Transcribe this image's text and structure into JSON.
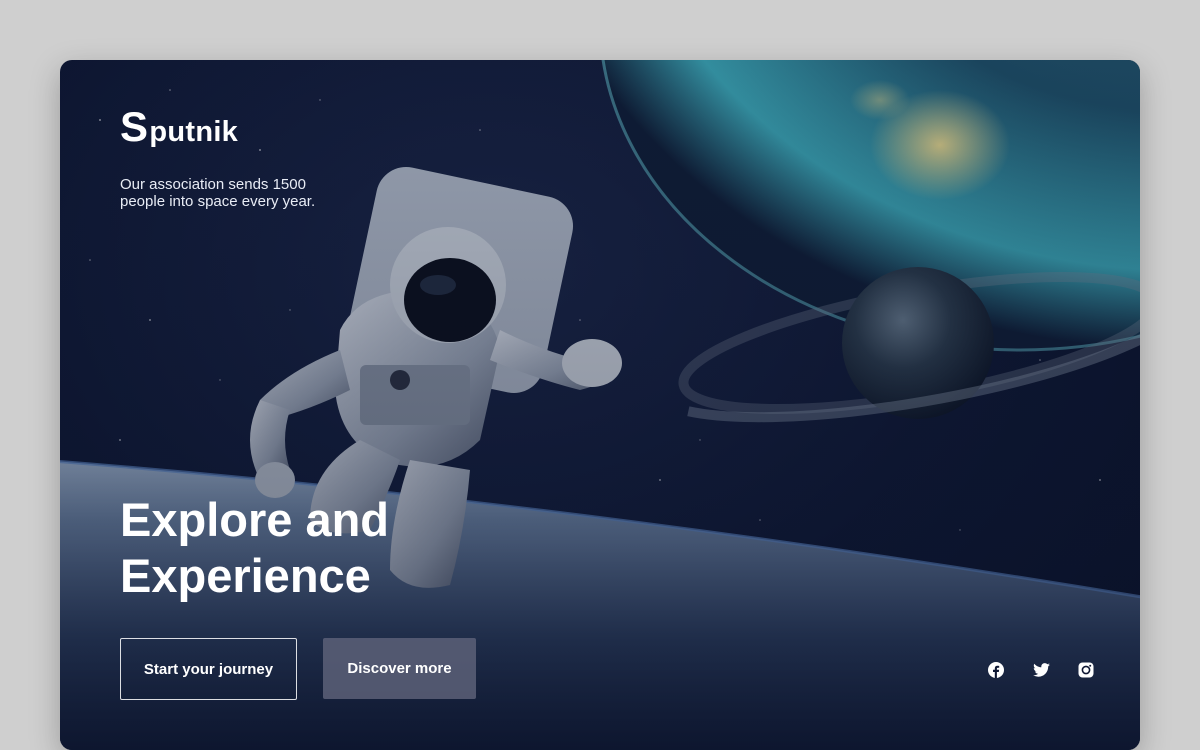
{
  "brand": {
    "logo_initial": "S",
    "logo_rest": "putnik"
  },
  "hero": {
    "tagline": "Our association sends 1500 people into space every year.",
    "title_line1": "Explore and",
    "title_line2": "Experience"
  },
  "actions": {
    "primary_label": "Start your journey",
    "secondary_label": "Discover more"
  },
  "social": [
    {
      "icon": "facebook-icon"
    },
    {
      "icon": "twitter-icon"
    },
    {
      "icon": "instagram-icon"
    }
  ],
  "colors": {
    "page_background": "#cfcfcf",
    "space_background": "#0e1733",
    "text_primary": "#ffffff",
    "secondary_button": "#5c6078"
  }
}
